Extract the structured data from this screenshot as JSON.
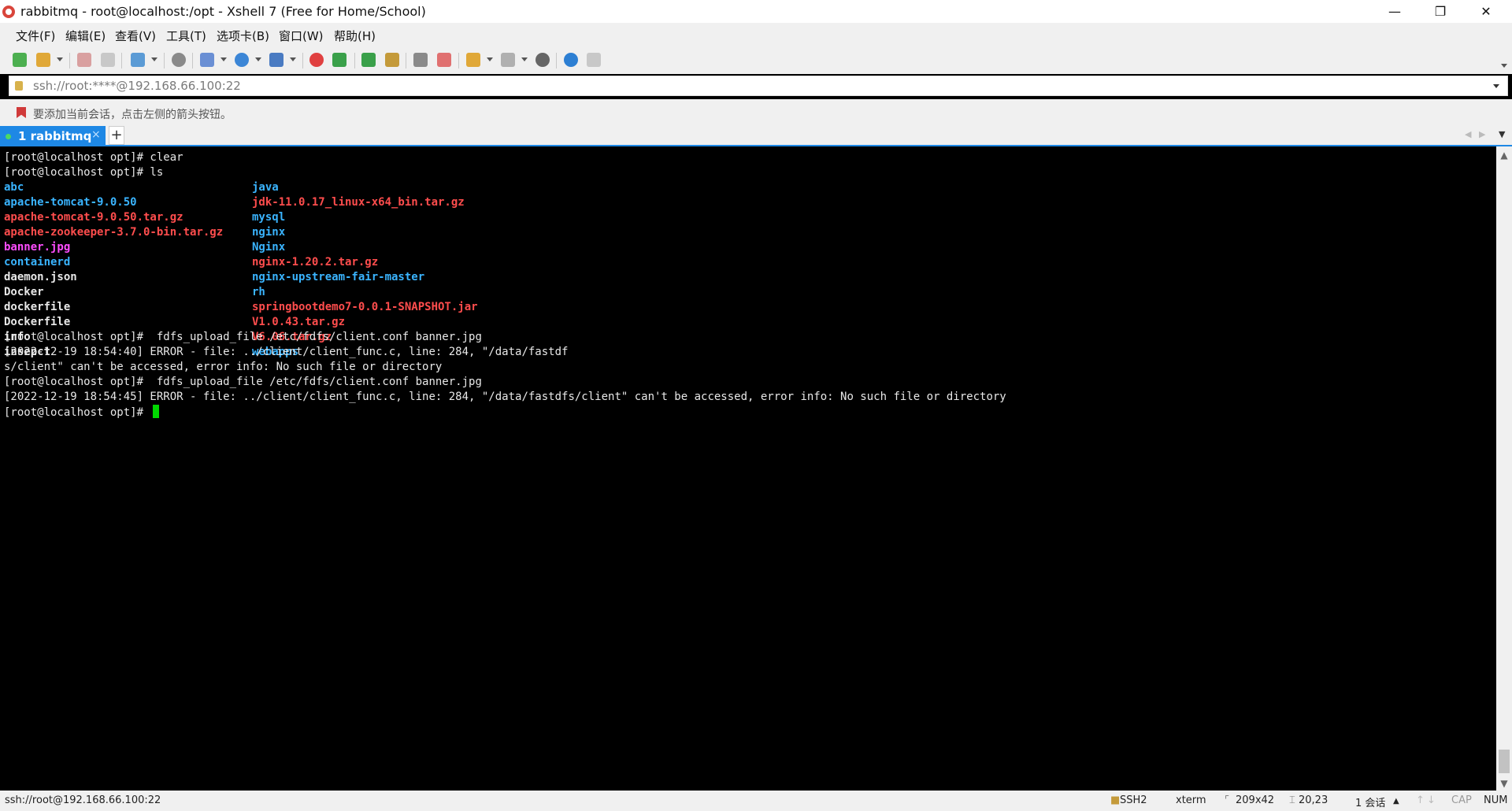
{
  "window": {
    "title": "rabbitmq - root@localhost:/opt - Xshell 7 (Free for Home/School)",
    "minimize": "—",
    "restore": "❐",
    "close": "✕"
  },
  "menu": [
    "文件(F)",
    "编辑(E)",
    "查看(V)",
    "工具(T)",
    "选项卡(B)",
    "窗口(W)",
    "帮助(H)"
  ],
  "address": {
    "value": "ssh://root:****@192.168.66.100:22"
  },
  "hint": {
    "text": "要添加当前会话，点击左侧的箭头按钮。"
  },
  "tab": {
    "label": "1 rabbitmq",
    "close": "×",
    "add": "+"
  },
  "terminal": {
    "colors": {
      "dir": "#3ab4ff",
      "archive": "#ff4d4d",
      "image": "#ff4dff",
      "plain": "#e8e8e8",
      "cursor": "#00d800"
    },
    "line_clear": "[root@localhost opt]# clear",
    "line_ls": "[root@localhost opt]# ls",
    "files_col1": [
      {
        "name": "abc",
        "color": "#3ab4ff"
      },
      {
        "name": "apache-tomcat-9.0.50",
        "color": "#3ab4ff"
      },
      {
        "name": "apache-tomcat-9.0.50.tar.gz",
        "color": "#ff4d4d"
      },
      {
        "name": "apache-zookeeper-3.7.0-bin.tar.gz",
        "color": "#ff4d4d"
      },
      {
        "name": "banner.jpg",
        "color": "#ff4dff"
      },
      {
        "name": "containerd",
        "color": "#3ab4ff"
      },
      {
        "name": "daemon.json",
        "color": "#e8e8e8"
      },
      {
        "name": "Docker",
        "color": "#e8e8e8"
      },
      {
        "name": "dockerfile",
        "color": "#e8e8e8"
      },
      {
        "name": "Dockerfile",
        "color": "#e8e8e8"
      },
      {
        "name": "info",
        "color": "#e8e8e8"
      },
      {
        "name": "insepct",
        "color": "#e8e8e8"
      }
    ],
    "files_col2": [
      {
        "name": "java",
        "color": "#3ab4ff"
      },
      {
        "name": "jdk-11.0.17_linux-x64_bin.tar.gz",
        "color": "#ff4d4d"
      },
      {
        "name": "mysql",
        "color": "#3ab4ff"
      },
      {
        "name": "nginx",
        "color": "#3ab4ff"
      },
      {
        "name": "Nginx",
        "color": "#3ab4ff"
      },
      {
        "name": "nginx-1.20.2.tar.gz",
        "color": "#ff4d4d"
      },
      {
        "name": "nginx-upstream-fair-master",
        "color": "#3ab4ff"
      },
      {
        "name": "rh",
        "color": "#3ab4ff"
      },
      {
        "name": "springbootdemo7-0.0.1-SNAPSHOT.jar",
        "color": "#ff4d4d"
      },
      {
        "name": "V1.0.43.tar.gz",
        "color": "#ff4d4d"
      },
      {
        "name": "V6.06.tar.gz",
        "color": "#ff4d4d"
      },
      {
        "name": "webapps",
        "color": "#3ab4ff"
      }
    ],
    "line_upload1": "[root@localhost opt]#  fdfs_upload_file /etc/fdfs/client.conf banner.jpg",
    "line_error1a": "[2022-12-19 18:54:40] ERROR - file: ../client/client_func.c, line: 284, \"/data/fastdf",
    "line_error1b": "s/client\" can't be accessed, error info: No such file or directory",
    "line_upload2": "[root@localhost opt]#  fdfs_upload_file /etc/fdfs/client.conf banner.jpg",
    "line_error2": "[2022-12-19 18:54:45] ERROR - file: ../client/client_func.c, line: 284, \"/data/fastdfs/client\" can't be accessed, error info: No such file or directory",
    "prompt": "[root@localhost opt]# "
  },
  "status": {
    "connection": "ssh://root@192.168.66.100:22",
    "protocol": "SSH2",
    "terminal_type": "xterm",
    "size": "209x42",
    "cursor_pos": "20,23",
    "sessions": "1 会话",
    "cap": "CAP",
    "num": "NUM"
  }
}
